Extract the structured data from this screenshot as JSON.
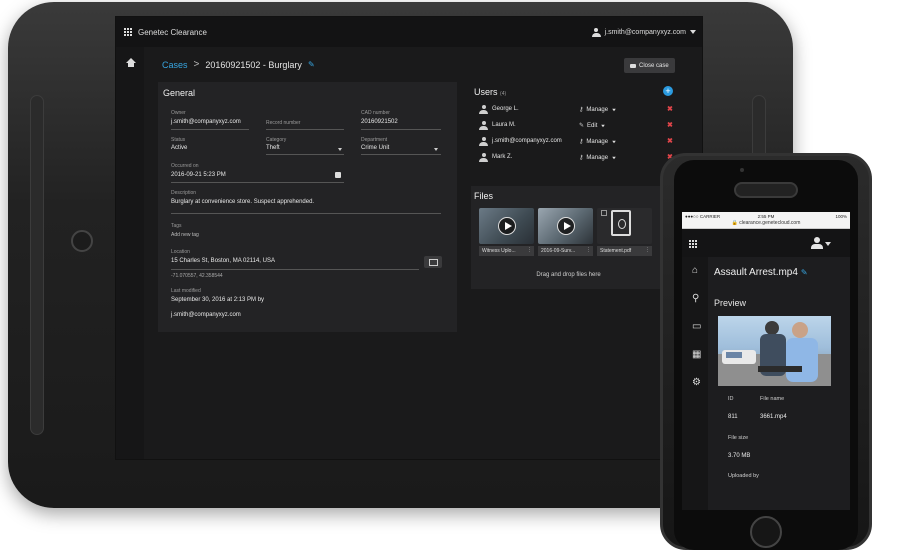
{
  "tablet": {
    "topbar": {
      "app_name": "Genetec Clearance",
      "user_email": "j.smith@companyxyz.com"
    },
    "breadcrumb": {
      "root": "Cases",
      "separator": ">",
      "current": "20160921502 - Burglary"
    },
    "close_case_label": "Close case",
    "general": {
      "heading": "General",
      "owner_label": "Owner",
      "owner_value": "j.smith@companyxyz.com",
      "record_label": "Record number",
      "cad_label": "CAD number",
      "cad_value": "20160921502",
      "status_label": "Status",
      "status_value": "Active",
      "category_label": "Category",
      "category_value": "Theft",
      "department_label": "Department",
      "department_value": "Crime Unit",
      "occurred_label": "Occurred on",
      "occurred_value": "2016-09-21 5:23 PM",
      "description_label": "Description",
      "description_value": "Burglary at convenience store. Suspect apprehended.",
      "tags_label": "Tags",
      "tags_placeholder": "Add new tag",
      "location_label": "Location",
      "location_value": "15 Charles St, Boston, MA 02114, USA",
      "coordinates": "-71.070557, 42.358544",
      "last_modified_label": "Last modified",
      "last_modified_value": "September 30, 2016 at 2:13 PM by",
      "last_modified_by": "j.smith@companyxyz.com"
    },
    "users": {
      "heading": "Users",
      "count": "(4)",
      "rows": [
        {
          "name": "George L.",
          "role": "Manage"
        },
        {
          "name": "Laura M.",
          "role": "Edit"
        },
        {
          "name": "j.smith@companyxyz.com",
          "role": "Manage"
        },
        {
          "name": "Mark Z.",
          "role": "Manage"
        }
      ],
      "remove_glyph": "✖",
      "add_glyph": "+"
    },
    "files": {
      "heading": "Files",
      "items": [
        {
          "name": "Witness Uplo..."
        },
        {
          "name": "2016-09-Surv..."
        },
        {
          "name": "Statement.pdf"
        }
      ],
      "menu_glyph": "⋮",
      "drop_text": "Drag and drop files here"
    }
  },
  "phone": {
    "status": {
      "carrier": "●●●○○ CARRIER",
      "time": "2:55 PM",
      "battery": "100%"
    },
    "url": "🔒 clearance.genetecloud.com",
    "file_title": "Assault Arrest.mp4",
    "preview_heading": "Preview",
    "id_label": "ID",
    "id_value": "811",
    "file_name_label": "File name",
    "file_name_value": "3661.mp4",
    "file_size_label": "File size",
    "file_size_value": "3.70 MB",
    "uploaded_by_label": "Uploaded by",
    "nav_icons": {
      "home": "⌂",
      "search": "⚲",
      "folder": "▭",
      "film": "▦",
      "settings": "⚙"
    }
  },
  "colors": {
    "accent": "#37a5e0",
    "danger": "#e0454a",
    "panel": "#232325",
    "screen": "#1a1a1b"
  }
}
